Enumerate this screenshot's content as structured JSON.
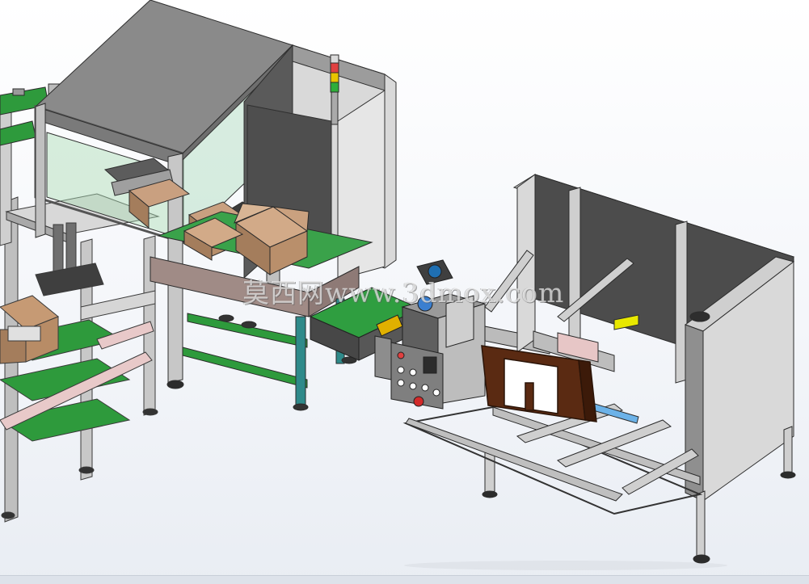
{
  "watermark": {
    "text": "莫西网www.3dmox.com"
  },
  "colors": {
    "frame_gray": "#c9c9c9",
    "panel_gray": "#7d7d7d",
    "dark_panel": "#4d4d4d",
    "conveyor_green": "#2e9a3c",
    "box_brown": "#a47d5c",
    "ledger_brown": "#5a2a12",
    "light_red": "#e04040",
    "light_yellow": "#e8c400",
    "light_green": "#2fae3a"
  }
}
